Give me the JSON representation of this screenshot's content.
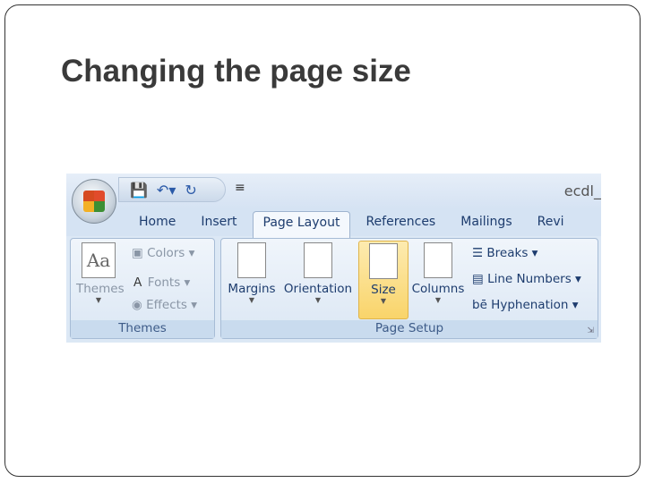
{
  "slide": {
    "title": "Changing the page size"
  },
  "word": {
    "document_title": "ecdl_",
    "qat": [
      "save-icon",
      "undo-icon",
      "redo-icon",
      "customize-icon"
    ],
    "tabs": [
      "Home",
      "Insert",
      "Page Layout",
      "References",
      "Mailings",
      "Revi"
    ],
    "active_tab": "Page Layout",
    "themes_group": {
      "label": "Themes",
      "themes": "Themes",
      "colors": "Colors",
      "fonts": "Fonts",
      "effects": "Effects"
    },
    "page_setup_group": {
      "label": "Page Setup",
      "margins": "Margins",
      "orientation": "Orientation",
      "size": "Size",
      "columns": "Columns",
      "breaks": "Breaks",
      "line_numbers": "Line Numbers",
      "hyphenation": "Hyphenation"
    },
    "highlight_color": "#f9d46a"
  }
}
